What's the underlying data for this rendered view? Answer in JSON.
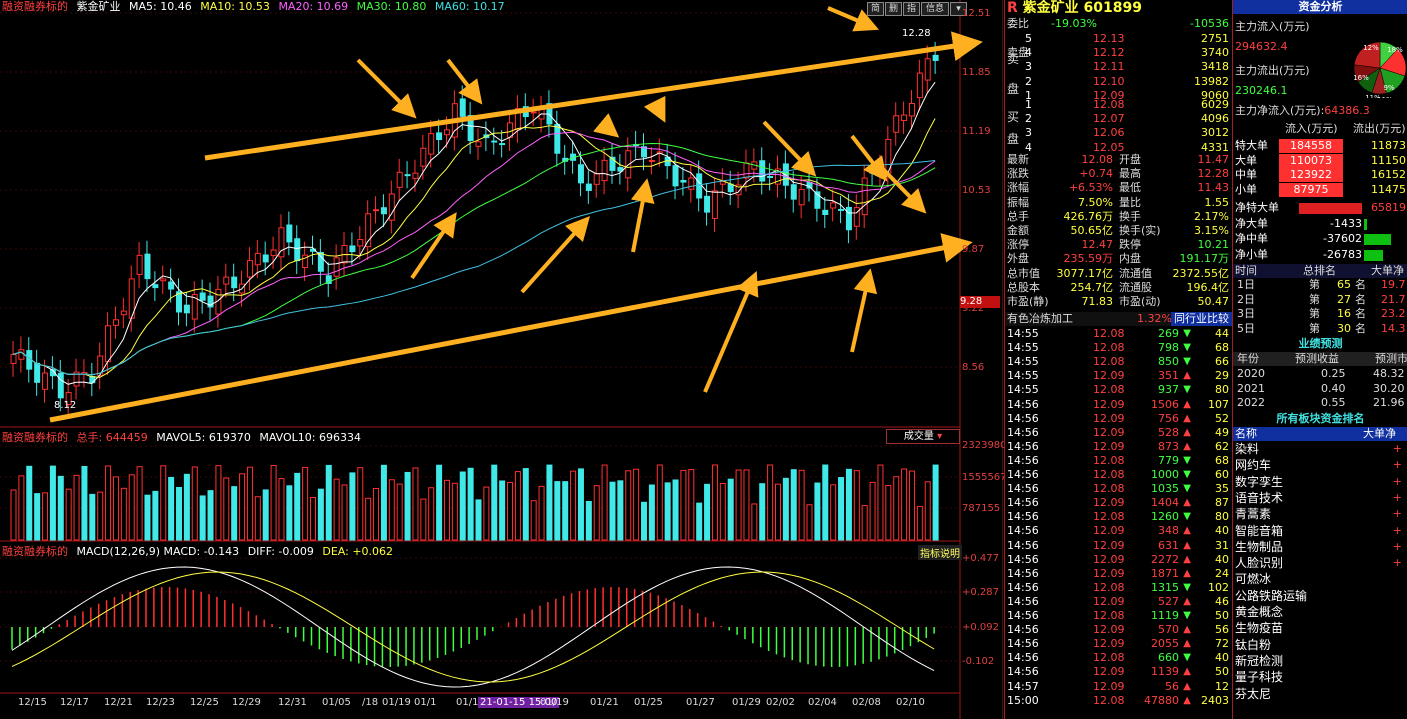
{
  "header": {
    "prefix": "融资融券标的",
    "stock": "紫金矿业",
    "ma5": "MA5: 10.46",
    "ma10": "MA10: 10.53",
    "ma20": "MA20: 10.69",
    "ma30": "MA30: 10.80",
    "ma60": "MA60: 10.17"
  },
  "toolbar": {
    "btn1": "简",
    "btn2": "删",
    "btn3": "指",
    "btn4": "信息"
  },
  "price_axis": [
    "12.51",
    "11.85",
    "11.19",
    "10.53",
    "9.87",
    "9.22",
    "8.56"
  ],
  "price_badge": "9.28",
  "price_marks": {
    "high": "12.28",
    "low": "8.12"
  },
  "volume": {
    "title": "融资融券标的",
    "total": "总手: 644459",
    "mavol5": "MAVOL5: 619370",
    "mavol10": "MAVOL10: 696334",
    "selector": "成交量",
    "axis": [
      "2323980",
      "1555567",
      "787155"
    ]
  },
  "macd": {
    "title": "融资融券标的",
    "params": "MACD(12,26,9) MACD: -0.143",
    "diff": "DIFF: -0.009",
    "dea": "DEA: +0.062",
    "help": "指标说明",
    "axis": [
      "+0.477",
      "+0.287",
      "+0.092",
      "-0.102"
    ]
  },
  "dates": [
    "12/15",
    "12/17",
    "12/21",
    "12/23",
    "12/25",
    "12/29",
    "12/31",
    "01/05",
    "/18",
    "01/19",
    "01/1",
    "01/1",
    "21-01-15 15:00",
    "01/19",
    "01/21",
    "01/25",
    "01/27",
    "01/29",
    "02/02",
    "02/04",
    "02/08",
    "02/10"
  ],
  "colors": {
    "up": "#ff3030",
    "down": "#40e8e8",
    "arrow": "#ffb020",
    "accent": "#1030a0"
  },
  "quote": {
    "title": "紫金矿业 601899",
    "webi_label": "委比",
    "webi_value": "-19.03%",
    "webi_diff": "-10536",
    "sell_label": "卖盘",
    "sell": [
      {
        "n": "5",
        "p": "12.13",
        "v": "2751"
      },
      {
        "n": "4",
        "p": "12.12",
        "v": "3740"
      },
      {
        "n": "3",
        "p": "12.11",
        "v": "3418"
      },
      {
        "n": "2",
        "p": "12.10",
        "v": "13982"
      },
      {
        "n": "1",
        "p": "12.09",
        "v": "9060"
      }
    ],
    "buy_label": "买盘",
    "buy": [
      {
        "n": "1",
        "p": "12.08",
        "v": "6029"
      },
      {
        "n": "2",
        "p": "12.07",
        "v": "4096"
      },
      {
        "n": "3",
        "p": "12.06",
        "v": "3012"
      },
      {
        "n": "4",
        "p": "12.05",
        "v": "4331"
      }
    ],
    "stats": [
      {
        "k1": "最新",
        "v1": "12.08",
        "k2": "开盘",
        "v2": "11.47"
      },
      {
        "k1": "涨跌",
        "v1": "+0.74",
        "k2": "最高",
        "v2": "12.28"
      },
      {
        "k1": "涨幅",
        "v1": "+6.53%",
        "k2": "最低",
        "v2": "11.43"
      },
      {
        "k1": "振幅",
        "v1": "7.50%",
        "k2": "量比",
        "v2": "1.55"
      },
      {
        "k1": "总手",
        "v1": "426.76万",
        "k2": "换手",
        "v2": "2.17%"
      },
      {
        "k1": "金额",
        "v1": "50.65亿",
        "k2": "换手(实)",
        "v2": "3.15%"
      },
      {
        "k1": "涨停",
        "v1": "12.47",
        "k2": "跌停",
        "v2": "10.21"
      },
      {
        "k1": "外盘",
        "v1": "235.59万",
        "k2": "内盘",
        "v2": "191.17万"
      },
      {
        "k1": "总市值",
        "v1": "3077.17亿",
        "k2": "流通值",
        "v2": "2372.55亿"
      },
      {
        "k1": "总股本",
        "v1": "254.7亿",
        "k2": "流通股",
        "v2": "196.4亿"
      },
      {
        "k1": "市盈(静)",
        "v1": "71.83",
        "k2": "市盈(动)",
        "v2": "50.47"
      }
    ],
    "industry": "有色冶炼加工",
    "industry_pct": "1.32%",
    "compare_btn": "同行业比较",
    "ticks": [
      {
        "t": "14:55",
        "p": "12.08",
        "v": "269",
        "d": "down",
        "c": "44"
      },
      {
        "t": "14:55",
        "p": "12.08",
        "v": "798",
        "d": "down",
        "c": "68"
      },
      {
        "t": "14:55",
        "p": "12.08",
        "v": "850",
        "d": "down",
        "c": "66"
      },
      {
        "t": "14:55",
        "p": "12.09",
        "v": "351",
        "d": "up",
        "c": "29"
      },
      {
        "t": "14:55",
        "p": "12.08",
        "v": "937",
        "d": "down",
        "c": "80"
      },
      {
        "t": "14:56",
        "p": "12.09",
        "v": "1506",
        "d": "up",
        "c": "107"
      },
      {
        "t": "14:56",
        "p": "12.09",
        "v": "756",
        "d": "up",
        "c": "52"
      },
      {
        "t": "14:56",
        "p": "12.09",
        "v": "528",
        "d": "up",
        "c": "49"
      },
      {
        "t": "14:56",
        "p": "12.09",
        "v": "873",
        "d": "up",
        "c": "62"
      },
      {
        "t": "14:56",
        "p": "12.08",
        "v": "779",
        "d": "down",
        "c": "68"
      },
      {
        "t": "14:56",
        "p": "12.08",
        "v": "1000",
        "d": "down",
        "c": "60"
      },
      {
        "t": "14:56",
        "p": "12.08",
        "v": "1035",
        "d": "down",
        "c": "35"
      },
      {
        "t": "14:56",
        "p": "12.09",
        "v": "1404",
        "d": "up",
        "c": "87"
      },
      {
        "t": "14:56",
        "p": "12.08",
        "v": "1260",
        "d": "down",
        "c": "80"
      },
      {
        "t": "14:56",
        "p": "12.09",
        "v": "348",
        "d": "up",
        "c": "40"
      },
      {
        "t": "14:56",
        "p": "12.09",
        "v": "631",
        "d": "up",
        "c": "31"
      },
      {
        "t": "14:56",
        "p": "12.09",
        "v": "2272",
        "d": "up",
        "c": "40"
      },
      {
        "t": "14:56",
        "p": "12.09",
        "v": "1871",
        "d": "up",
        "c": "24"
      },
      {
        "t": "14:56",
        "p": "12.08",
        "v": "1315",
        "d": "down",
        "c": "102"
      },
      {
        "t": "14:56",
        "p": "12.09",
        "v": "527",
        "d": "up",
        "c": "46"
      },
      {
        "t": "14:56",
        "p": "12.08",
        "v": "1119",
        "d": "down",
        "c": "50"
      },
      {
        "t": "14:56",
        "p": "12.09",
        "v": "570",
        "d": "up",
        "c": "56"
      },
      {
        "t": "14:56",
        "p": "12.09",
        "v": "2055",
        "d": "up",
        "c": "72"
      },
      {
        "t": "14:56",
        "p": "12.08",
        "v": "660",
        "d": "down",
        "c": "40"
      },
      {
        "t": "14:56",
        "p": "12.09",
        "v": "1139",
        "d": "up",
        "c": "50"
      },
      {
        "t": "14:57",
        "p": "12.09",
        "v": "56",
        "d": "up",
        "c": "12"
      },
      {
        "t": "15:00",
        "p": "12.08",
        "v": "47880",
        "d": "up",
        "c": "2403"
      }
    ]
  },
  "funds": {
    "title": "资金分析",
    "inflow_label": "主力流入(万元)",
    "inflow": "294632.4",
    "outflow_label": "主力流出(万元)",
    "outflow": "230246.1",
    "net_label": "主力净流入(万元):",
    "net": "64386.3",
    "pie_labels": [
      "12%",
      "18%",
      "16%",
      "9%",
      "11%",
      "11%"
    ],
    "flow_head": [
      "流入(万元)",
      "流出(万元)"
    ],
    "flows": [
      {
        "k": "特大单",
        "in": "184558",
        "out": "11873"
      },
      {
        "k": "大单",
        "in": "110073",
        "out": "11150"
      },
      {
        "k": "中单",
        "in": "123922",
        "out": "16152"
      },
      {
        "k": "小单",
        "in": "87975",
        "out": "11475"
      }
    ],
    "nets": [
      {
        "k": "净特大单",
        "v": "65819",
        "frac": 0.7,
        "pos": true
      },
      {
        "k": "净大单",
        "v": "-1433",
        "frac": 0.02,
        "pos": false
      },
      {
        "k": "净中单",
        "v": "-37602",
        "frac": 0.38,
        "pos": false
      },
      {
        "k": "净小单",
        "v": "-26783",
        "frac": 0.27,
        "pos": false
      }
    ],
    "rank_head": [
      "时间",
      "总排名",
      "大单净"
    ],
    "ranks": [
      {
        "t": "1日",
        "p": "第",
        "r": "65",
        "s": "名",
        "v": "19.7"
      },
      {
        "t": "2日",
        "p": "第",
        "r": "27",
        "s": "名",
        "v": "21.7"
      },
      {
        "t": "3日",
        "p": "第",
        "r": "16",
        "s": "名",
        "v": "23.2"
      },
      {
        "t": "5日",
        "p": "第",
        "r": "30",
        "s": "名",
        "v": "14.3"
      }
    ],
    "forecast_title": "业绩预测",
    "forecast_head": [
      "年份",
      "预测收益",
      "预测市"
    ],
    "forecast": [
      {
        "y": "2020",
        "e": "0.25",
        "pe": "48.32"
      },
      {
        "y": "2021",
        "e": "0.40",
        "pe": "30.20"
      },
      {
        "y": "2022",
        "e": "0.55",
        "pe": "21.96"
      }
    ],
    "sector_title": "所有板块资金排名",
    "sector_head": [
      "名称",
      "大单净"
    ],
    "sectors": [
      "染料",
      "网约车",
      "数字孪生",
      "语音技术",
      "青蒿素",
      "智能音箱",
      "生物制品",
      "人脸识别",
      "可燃冰",
      "公路铁路运输",
      "黄金概念",
      "生物疫苗",
      "钛白粉",
      "新冠检测",
      "量子科技",
      "芬太尼"
    ]
  }
}
